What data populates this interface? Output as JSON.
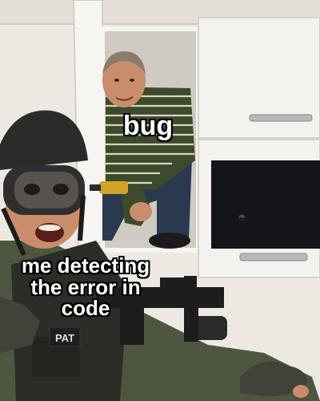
{
  "meme": {
    "caption_bug": "bug",
    "caption_detect": [
      "me detecting",
      "the error in",
      "code"
    ],
    "patch_text": "PAT"
  },
  "colors": {
    "wall": "#efece6",
    "cabinet": "#f4f3ef",
    "cabinet_shadow": "#d8d6d0",
    "oven_glass": "#141518",
    "shirt_green": "#3d4a2c",
    "shirt_stripe": "#d9d4bf",
    "jeans": "#2b3950",
    "skin": "#c98d6b",
    "helmet": "#2a2c2a",
    "uniform": "#4e5640",
    "caption_fill": "#ffffff",
    "caption_stroke": "#000000"
  }
}
